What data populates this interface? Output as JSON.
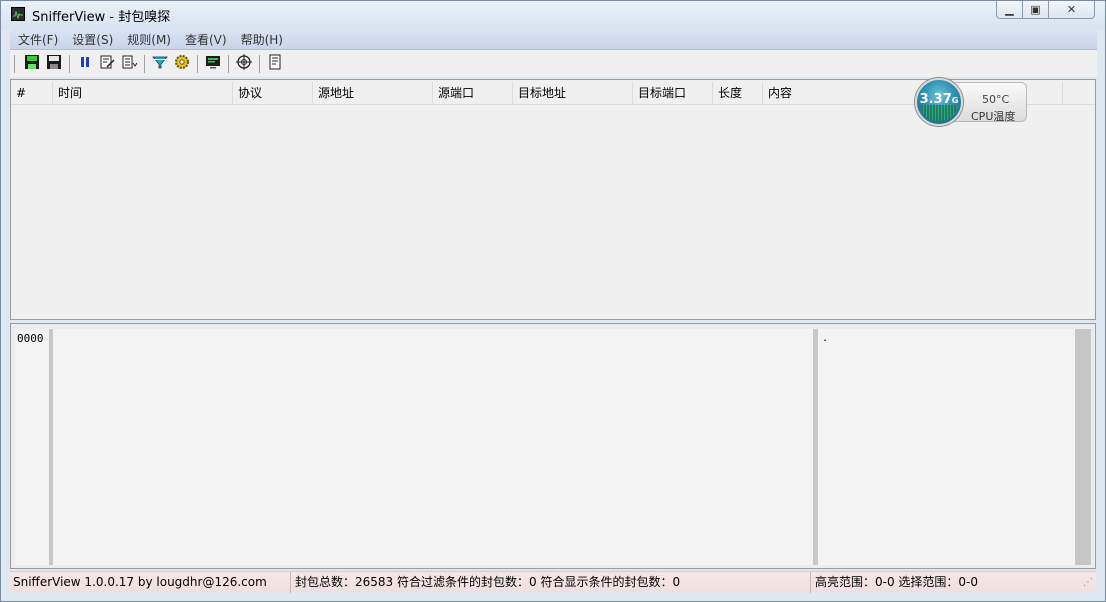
{
  "window": {
    "title": "SnifferView - 封包嗅探",
    "minimize_glyph": "▁",
    "maximize_glyph": "▣",
    "close_glyph": "✕"
  },
  "menu": [
    {
      "label": "文件(F)"
    },
    {
      "label": "设置(S)"
    },
    {
      "label": "规则(M)"
    },
    {
      "label": "查看(V)"
    },
    {
      "label": "帮助(H)"
    }
  ],
  "toolbar": {
    "buttons": [
      {
        "icon": "start-capture-icon"
      },
      {
        "icon": "save-icon"
      },
      {
        "icon": "pause-icon"
      },
      {
        "icon": "edit-rules-icon"
      },
      {
        "icon": "export-icon"
      },
      {
        "icon": "filter-icon"
      },
      {
        "icon": "settings-gear-icon"
      },
      {
        "icon": "monitor-icon"
      },
      {
        "icon": "target-icon"
      },
      {
        "icon": "copy-icon"
      }
    ]
  },
  "packet_list": {
    "columns": [
      "#",
      "时间",
      "协议",
      "源地址",
      "源端口",
      "目标地址",
      "目标端口",
      "长度",
      "内容"
    ],
    "rows": []
  },
  "cpu_widget": {
    "frequency": "3.37",
    "frequency_unit": "G",
    "temperature": "50°C",
    "label": "CPU温度"
  },
  "hex_view": {
    "offset": "0000",
    "bytes": "",
    "ascii": "."
  },
  "status": {
    "version": "SnifferView  1.0.0.17   by  lougdhr@126.com",
    "counts": "封包总数：26583  符合过滤条件的封包数：0  符合显示条件的封包数：0",
    "ranges": "高亮范围：0-0  选择范围：0-0"
  },
  "colors": {
    "menubar": "#c9d4ea",
    "statusbar": "#f7e6e6",
    "cpu_circle": "#2b8fb0"
  }
}
